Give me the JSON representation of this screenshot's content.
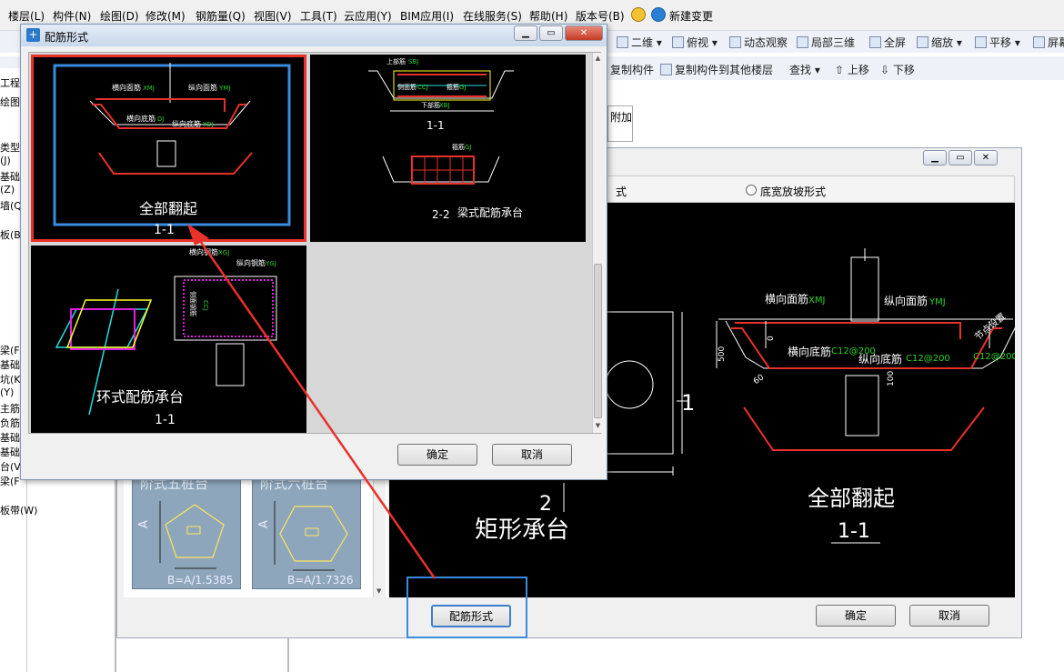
{
  "menubar": {
    "items": [
      "楼层(L)",
      "构件(N)",
      "绘图(D)",
      "修改(M)",
      "钢筋量(Q)",
      "视图(V)",
      "工具(T)",
      "云应用(Y)",
      "BIM应用(I)",
      "在线服务(S)",
      "帮助(H)",
      "版本号(B)"
    ],
    "new_change": "新建变更"
  },
  "toolbar": {
    "view_2d": "二维",
    "top_view": "俯视",
    "dynamic_observe": "动态观察",
    "local_3d": "局部三维",
    "fullscreen": "全屏",
    "zoom": "缩放",
    "pan": "平移",
    "screen": "屏幕",
    "copy_component": "复制构件",
    "copy_to_other_floor": "复制构件到其他楼层",
    "find": "查找",
    "move_up": "上移",
    "move_down": "下移",
    "attach": "附加"
  },
  "left_panel": {
    "items": [
      "工程设",
      "绘图输",
      "类型",
      "(J)",
      "基础",
      "(Z)",
      "墙(Q",
      "板(B",
      "梁(F",
      "基础",
      "坑(K",
      "(Y)",
      "主筋",
      "负筋",
      "基础",
      "基础",
      "台(V",
      "梁(F",
      "板带(W)"
    ]
  },
  "bg_dialog": {
    "radio_left": "式",
    "radio_right": "底宽放坡形式",
    "canvas": {
      "label_1": "1",
      "label_2": "2",
      "shape_title": "矩形承台",
      "section_title": "全部翻起",
      "section_sub": "1-1",
      "transverse_top": "横向面筋",
      "transverse_top_code": "XMJ",
      "longitudinal_top": "纵向面筋",
      "longitudinal_top_code": "YMJ",
      "transverse_bottom": "横向底筋",
      "longitudinal_bottom": "纵向底筋",
      "spec_1": "C12@200",
      "spec_2": "C12@200",
      "spec_3": "C12@200",
      "side_label": "节点设置",
      "dim_500": "500",
      "dim_0": "0",
      "dim_60": "60",
      "dim_100": "100"
    },
    "tiles": [
      {
        "title": "阶式五桩台",
        "cap": "B=A/1.5385",
        "axis": "A"
      },
      {
        "title": "阶式六桩台",
        "cap": "B=A/1.7326",
        "axis": "A"
      }
    ],
    "rebar_form_button": "配筋形式",
    "ok": "确定",
    "cancel": "取消"
  },
  "dialog": {
    "title": "配筋形式",
    "panels": [
      {
        "label": "全部翻起",
        "sub": "1-1",
        "selected": true
      },
      {
        "label": "梁式配筋承台",
        "sub_1": "1-1",
        "sub_2": "2-2",
        "selected": false
      },
      {
        "label": "环式配筋承台",
        "sub": "1-1",
        "selected": false
      }
    ],
    "panel1_texts": {
      "t1": "横向面筋",
      "t1c": "XMJ",
      "t2": "纵向面筋",
      "t2c": "YMJ",
      "t3": "横向底筋",
      "t3c": "DJ",
      "t4": "纵向底筋",
      "t4c": "YDJ"
    },
    "panel2_texts": {
      "t1": "上部筋",
      "t1c": "SBJ",
      "t2": "侧面筋",
      "t2c": "CCJ",
      "t3": "箍筋",
      "t3c": "GJ",
      "t4": "下部筋",
      "t4c": "XBJ",
      "t5": "箍筋",
      "t5c": "GJ"
    },
    "panel3_texts": {
      "t1": "横向钢筋",
      "t1c": "XGJ",
      "t2": "纵向钢筋",
      "t2c": "YGJ",
      "t3": "侧面钢筋",
      "t3c": "CCJ"
    },
    "ok": "确定",
    "cancel": "取消"
  },
  "colors": {
    "accent_red": "#e8312a",
    "highlight_blue": "#3a8ae0",
    "cad_green": "#29d329",
    "cad_magenta": "#e020e0",
    "cad_yellow": "#ffff20",
    "cad_cyan": "#20e0e0"
  }
}
